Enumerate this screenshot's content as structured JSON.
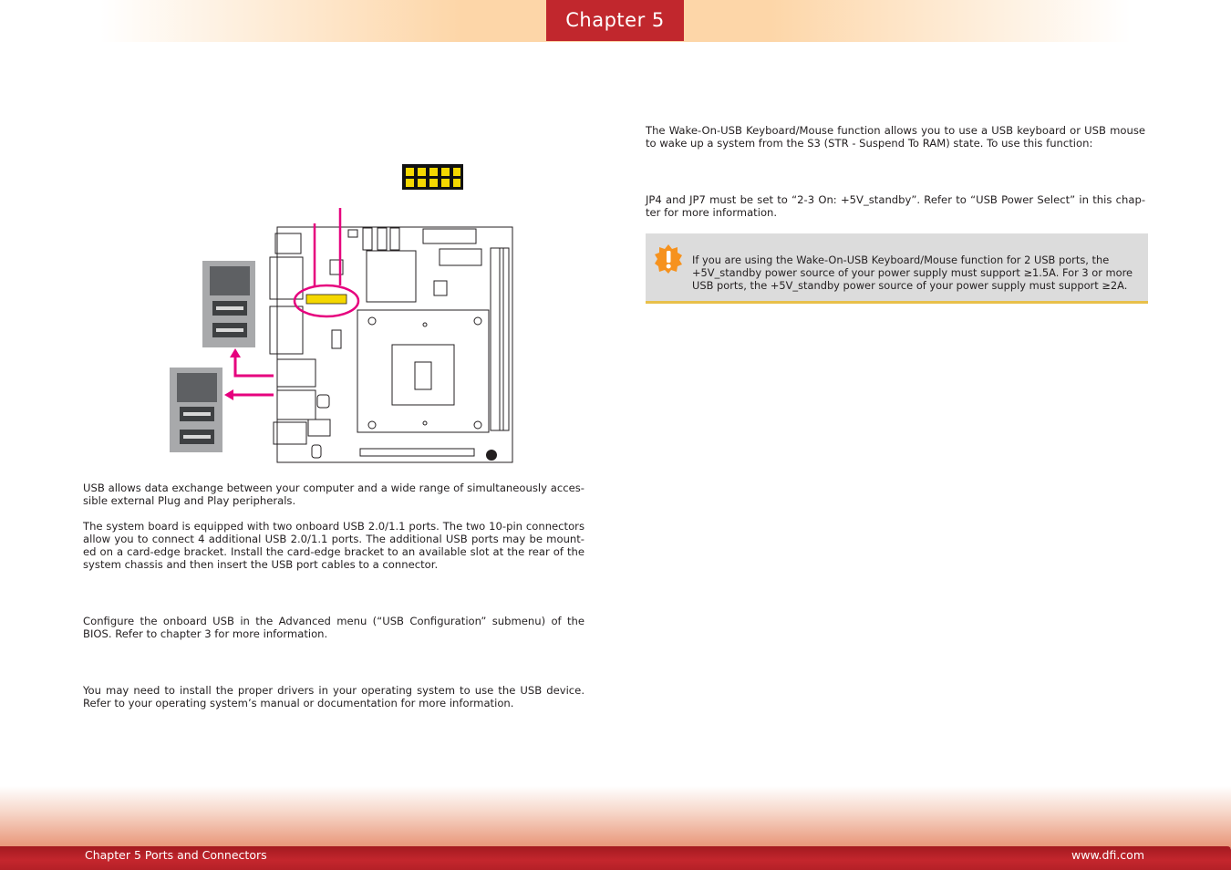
{
  "header": {
    "chapter_tab": "Chapter 5"
  },
  "left": {
    "p1": "USB allows data exchange between your computer and a wide range of simultaneously acces-sible external Plug and Play peripherals.",
    "p2": "The system board is equipped with two onboard USB 2.0/1.1 ports. The two 10-pin connectors allow you to connect 4 additional USB 2.0/1.1 ports. The additional USB ports may be mount-ed on a card-edge bracket. Install the card-edge bracket to an available slot at the rear of the system chassis and then insert the USB port cables to a connector.",
    "p3": "Configure the onboard USB in the Advanced menu (“USB Configuration” submenu) of the BIOS. Refer to chapter 3 for more information.",
    "p4": "You may need to install the proper drivers in your operating system to use the USB device. Refer to your operating system’s manual or documentation for more information."
  },
  "right": {
    "p1": "The Wake-On-USB Keyboard/Mouse function allows you to use a USB keyboard or USB mouse to wake up a system from the S3 (STR - Suspend To RAM) state. To use this function:",
    "p2": "JP4 and JP7 must be set to “2-3 On: +5V_standby”. Refer to “USB Power Select” in this chap-ter for more information.",
    "note": "If you are using the Wake-On-USB Keyboard/Mouse function for 2 USB ports, the +5V_standby power source of your power supply must support ≥1.5A. For 3 or more USB ports, the +5V_standby power source of your power supply must support ≥2A."
  },
  "icons": {
    "note": "exclamation-icon"
  },
  "colors": {
    "accent": "#c1272d",
    "highlight": "#e6007e",
    "pin": "#f5d800"
  },
  "footer": {
    "left": "Chapter 5 Ports and Connectors",
    "right": "www.dfi.com"
  }
}
